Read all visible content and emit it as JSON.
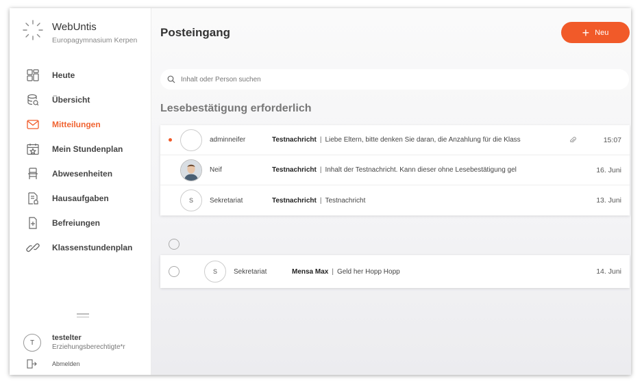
{
  "brand": {
    "name": "WebUntis",
    "school": "Europagymnasium Kerpen"
  },
  "nav": {
    "items": [
      {
        "label": "Heute",
        "icon": "dashboard-icon",
        "active": false
      },
      {
        "label": "Übersicht",
        "icon": "overview-icon",
        "active": false
      },
      {
        "label": "Mitteilungen",
        "icon": "mail-icon",
        "active": true
      },
      {
        "label": "Mein Stundenplan",
        "icon": "calendar-icon",
        "active": false
      },
      {
        "label": "Abwesenheiten",
        "icon": "chair-icon",
        "active": false
      },
      {
        "label": "Hausaufgaben",
        "icon": "homework-icon",
        "active": false
      },
      {
        "label": "Befreiungen",
        "icon": "exemption-icon",
        "active": false
      },
      {
        "label": "Klassenstundenplan",
        "icon": "link-icon",
        "active": false
      }
    ]
  },
  "user": {
    "initial": "T",
    "name": "testelter",
    "role": "Erziehungsberechtigte*r",
    "logout_label": "Abmelden"
  },
  "main": {
    "title": "Posteingang",
    "new_button": "Neu",
    "search_placeholder": "Inhalt oder Person suchen",
    "section_title": "Lesebestätigung erforderlich"
  },
  "messages_required": [
    {
      "sender": "adminneifer",
      "subject": "Testnachricht",
      "preview": "Liebe Eltern, bitte denken Sie daran, die Anzahlung für die Klass",
      "date": "15:07",
      "unread": true,
      "attachment": true,
      "avatar": ""
    },
    {
      "sender": "Neif",
      "subject": "Testnachricht",
      "preview": "Inhalt der Testnachricht. Kann dieser ohne Lesebestätigung gel",
      "date": "16. Juni",
      "unread": false,
      "attachment": false,
      "avatar": "photo"
    },
    {
      "sender": "Sekretariat",
      "subject": "Testnachricht",
      "preview": "Testnachricht",
      "date": "13. Juni",
      "unread": false,
      "attachment": false,
      "avatar": "S"
    }
  ],
  "messages_other": [
    {
      "sender": "Sekretariat",
      "subject": "Mensa Max",
      "preview": "Geld her Hopp Hopp",
      "date": "14. Juni",
      "avatar": "S"
    }
  ],
  "colors": {
    "accent": "#f15a29"
  }
}
